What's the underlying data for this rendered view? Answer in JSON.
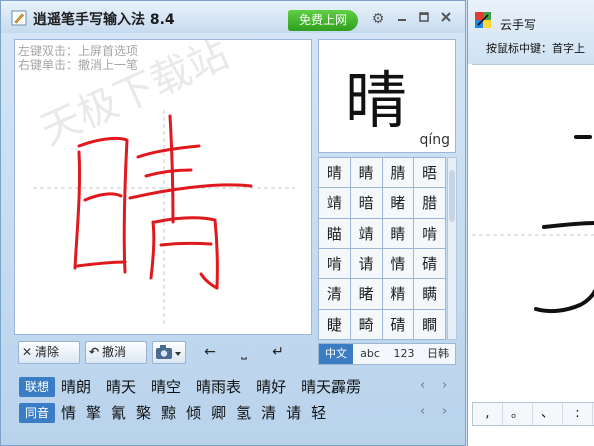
{
  "main_window": {
    "title": "逍遥笔手写输入法 8.4",
    "online_button": "免费上网",
    "hints": [
      "左键双击：上屏首选项",
      "右键单击：撤消上一笔"
    ],
    "watermark": "天极下载站",
    "toolbar": {
      "clear_label": "清除",
      "undo_label": "撤消",
      "left_label": "←",
      "space_label": "⎵",
      "enter_label": "↵"
    }
  },
  "preview": {
    "char": "晴",
    "pinyin": "qíng"
  },
  "candidates": [
    "晴",
    "睛",
    "腈",
    "晤",
    "靖",
    "暗",
    "睹",
    "腊",
    "瞄",
    "靖",
    "睛",
    "啃",
    "啃",
    "请",
    "情",
    "碃",
    "清",
    "睹",
    "精",
    "瞒",
    "睫",
    "畸",
    "碃",
    "瞷"
  ],
  "lang_tabs": [
    "中文",
    "abc",
    "123",
    "日韩"
  ],
  "association": {
    "label": "联想",
    "items": [
      "晴朗",
      "晴天",
      "晴空",
      "晴雨表",
      "晴好",
      "晴天霹雳"
    ]
  },
  "homophone": {
    "label": "同音",
    "items": [
      "情",
      "擎",
      "氰",
      "檠",
      "黥",
      "倾",
      "卿",
      "氢",
      "清",
      "请",
      "轻"
    ]
  },
  "cloud_window": {
    "title": "云手写",
    "hint": "按鼠标中键：首字上",
    "punct": [
      ",",
      "。",
      "、",
      ":"
    ]
  },
  "colors": {
    "accent": "#3b7dc4",
    "stroke": "#e0191e",
    "online": "#3aaa2a"
  }
}
